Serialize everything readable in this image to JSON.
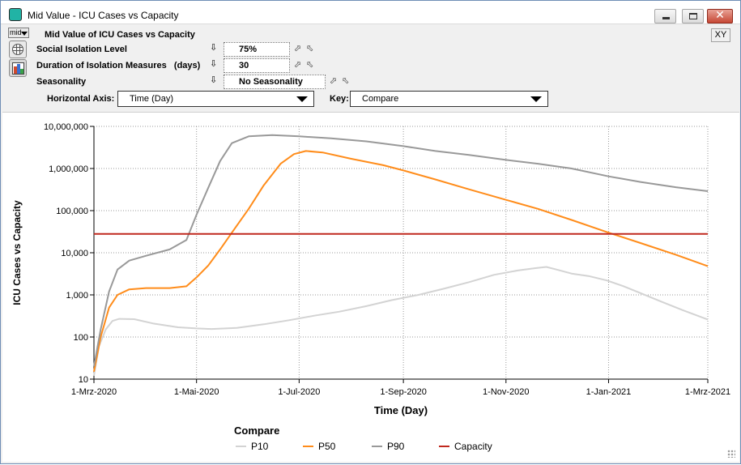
{
  "window": {
    "title": "Mid Value - ICU Cases vs Capacity",
    "minimize_label": "",
    "maximize_label": "",
    "close_label": "✕"
  },
  "header": {
    "mode_selector": "mid",
    "chart_title": "Mid Value of ICU Cases vs Capacity",
    "xy_button": "XY"
  },
  "params": [
    {
      "label": "Social Isolation Level",
      "value": "75%"
    },
    {
      "label": "Duration of Isolation Measures   (days)",
      "value": "30"
    },
    {
      "label": "Seasonality",
      "value": "No Seasonality"
    }
  ],
  "axis_controls": {
    "horizontal_axis_label": "Horizontal Axis:",
    "horizontal_axis_value": "Time (Day)",
    "key_label": "Key:",
    "key_value": "Compare"
  },
  "legend": {
    "title": "Compare",
    "items": [
      "P10",
      "P50",
      "P90",
      "Capacity"
    ]
  },
  "colors": {
    "P10": "#d3d3d3",
    "P50": "#ff8c1a",
    "P90": "#999999",
    "Capacity": "#c0281e"
  },
  "chart_data": {
    "type": "line",
    "xlabel": "Time (Day)",
    "ylabel": "ICU Cases vs Capacity",
    "y_scale": "log",
    "ylim": [
      10,
      10000000
    ],
    "xlim": [
      "2020-03-01",
      "2021-03-01"
    ],
    "y_ticks": [
      "10",
      "100",
      "1,000",
      "10,000",
      "100,000",
      "1,000,000",
      "10,000,000"
    ],
    "x_ticks": [
      "1-Mrz-2020",
      "1-Mai-2020",
      "1-Jul-2020",
      "1-Sep-2020",
      "1-Nov-2020",
      "1-Jan-2021",
      "1-Mrz-2021"
    ],
    "grid": true,
    "legend_position": "bottom",
    "series": [
      {
        "name": "P10",
        "points": [
          [
            "2020-03-01",
            12
          ],
          [
            "2020-03-04",
            60
          ],
          [
            "2020-03-08",
            150
          ],
          [
            "2020-03-12",
            240
          ],
          [
            "2020-03-16",
            270
          ],
          [
            "2020-03-25",
            265
          ],
          [
            "2020-04-05",
            210
          ],
          [
            "2020-04-20",
            170
          ],
          [
            "2020-05-01",
            160
          ],
          [
            "2020-05-10",
            155
          ],
          [
            "2020-05-25",
            165
          ],
          [
            "2020-06-10",
            200
          ],
          [
            "2020-06-25",
            250
          ],
          [
            "2020-07-10",
            320
          ],
          [
            "2020-07-25",
            400
          ],
          [
            "2020-08-10",
            540
          ],
          [
            "2020-08-25",
            750
          ],
          [
            "2020-09-10",
            1000
          ],
          [
            "2020-09-25",
            1400
          ],
          [
            "2020-10-10",
            2000
          ],
          [
            "2020-10-25",
            3000
          ],
          [
            "2020-11-08",
            3800
          ],
          [
            "2020-11-18",
            4300
          ],
          [
            "2020-11-25",
            4600
          ],
          [
            "2020-12-01",
            4000
          ],
          [
            "2020-12-10",
            3200
          ],
          [
            "2020-12-20",
            2800
          ],
          [
            "2020-12-31",
            2200
          ],
          [
            "2021-01-10",
            1600
          ],
          [
            "2021-01-20",
            1100
          ],
          [
            "2021-02-01",
            700
          ],
          [
            "2021-02-15",
            420
          ],
          [
            "2021-03-01",
            260
          ]
        ]
      },
      {
        "name": "P50",
        "points": [
          [
            "2020-03-01",
            15
          ],
          [
            "2020-03-05",
            100
          ],
          [
            "2020-03-10",
            500
          ],
          [
            "2020-03-15",
            1000
          ],
          [
            "2020-03-22",
            1350
          ],
          [
            "2020-04-01",
            1450
          ],
          [
            "2020-04-15",
            1450
          ],
          [
            "2020-04-25",
            1600
          ],
          [
            "2020-05-01",
            2600
          ],
          [
            "2020-05-08",
            5000
          ],
          [
            "2020-05-15",
            12000
          ],
          [
            "2020-05-22",
            30000
          ],
          [
            "2020-06-01",
            110000
          ],
          [
            "2020-06-10",
            400000
          ],
          [
            "2020-06-20",
            1300000
          ],
          [
            "2020-06-28",
            2200000
          ],
          [
            "2020-07-05",
            2600000
          ],
          [
            "2020-07-15",
            2400000
          ],
          [
            "2020-08-01",
            1700000
          ],
          [
            "2020-08-20",
            1200000
          ],
          [
            "2020-09-01",
            900000
          ],
          [
            "2020-09-20",
            550000
          ],
          [
            "2020-10-10",
            320000
          ],
          [
            "2020-11-01",
            180000
          ],
          [
            "2020-11-20",
            110000
          ],
          [
            "2020-12-10",
            60000
          ],
          [
            "2021-01-01",
            30000
          ],
          [
            "2021-01-20",
            17000
          ],
          [
            "2021-02-10",
            9000
          ],
          [
            "2021-03-01",
            4800
          ]
        ]
      },
      {
        "name": "P90",
        "points": [
          [
            "2020-03-01",
            20
          ],
          [
            "2020-03-05",
            150
          ],
          [
            "2020-03-10",
            1200
          ],
          [
            "2020-03-15",
            4000
          ],
          [
            "2020-03-22",
            6500
          ],
          [
            "2020-04-01",
            8500
          ],
          [
            "2020-04-15",
            12000
          ],
          [
            "2020-04-25",
            20000
          ],
          [
            "2020-05-01",
            80000
          ],
          [
            "2020-05-08",
            350000
          ],
          [
            "2020-05-15",
            1500000
          ],
          [
            "2020-05-22",
            4000000
          ],
          [
            "2020-06-01",
            5800000
          ],
          [
            "2020-06-15",
            6200000
          ],
          [
            "2020-07-01",
            5800000
          ],
          [
            "2020-07-20",
            5200000
          ],
          [
            "2020-08-10",
            4400000
          ],
          [
            "2020-09-01",
            3400000
          ],
          [
            "2020-09-20",
            2600000
          ],
          [
            "2020-10-10",
            2100000
          ],
          [
            "2020-11-01",
            1600000
          ],
          [
            "2020-11-20",
            1300000
          ],
          [
            "2020-12-10",
            1000000
          ],
          [
            "2021-01-01",
            650000
          ],
          [
            "2021-01-20",
            480000
          ],
          [
            "2021-02-10",
            360000
          ],
          [
            "2021-03-01",
            290000
          ]
        ]
      },
      {
        "name": "Capacity",
        "points": [
          [
            "2020-03-01",
            28000
          ],
          [
            "2021-03-01",
            28000
          ]
        ]
      }
    ]
  }
}
